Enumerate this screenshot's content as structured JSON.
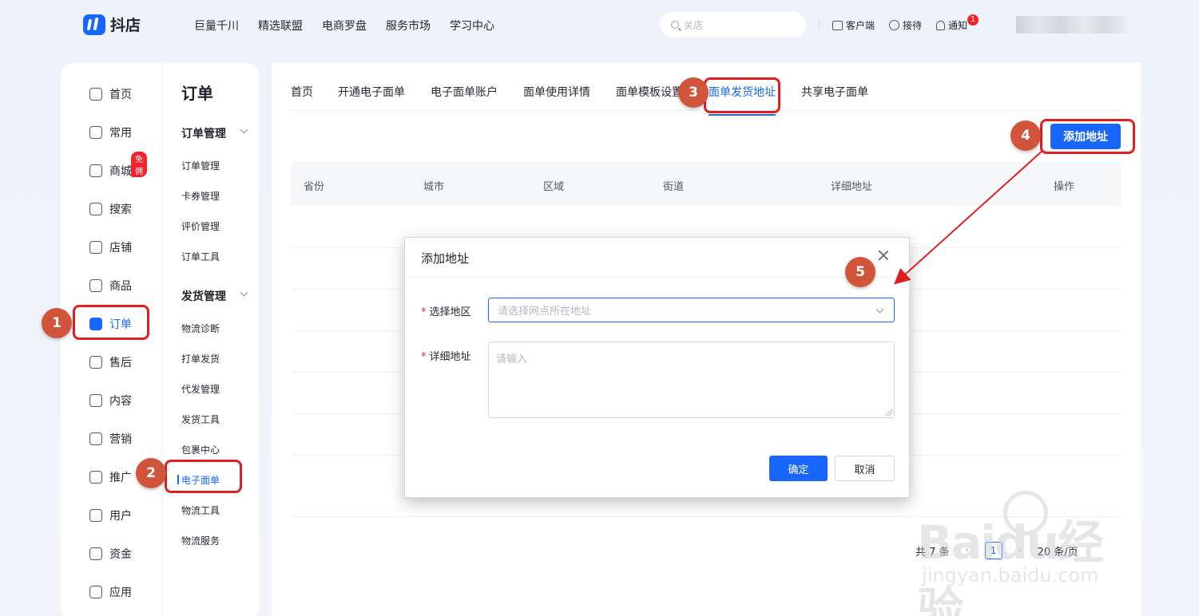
{
  "header": {
    "logo": "抖店",
    "nav": [
      "巨量千川",
      "精选联盟",
      "电商罗盘",
      "服务市场",
      "学习中心"
    ],
    "search_placeholder": "关店",
    "actions": [
      "客户端",
      "接待",
      "通知"
    ],
    "notice_count": "1"
  },
  "sidebar": {
    "items": [
      "首页",
      "常用",
      "商城",
      "搜索",
      "店铺",
      "商品",
      "订单",
      "售后",
      "内容",
      "营销",
      "推广",
      "用户",
      "资金",
      "应用"
    ],
    "mall_badge": "免佣",
    "active_item": "订单"
  },
  "submenu": {
    "title": "订单",
    "group1": "订单管理",
    "group1_items": [
      "订单管理",
      "卡券管理",
      "评价管理",
      "订单工具"
    ],
    "group2": "发货管理",
    "group2_items": [
      "物流诊断",
      "打单发货",
      "代发管理",
      "发货工具",
      "包裹中心",
      "电子面单",
      "物流工具",
      "物流服务"
    ],
    "active_item": "电子面单"
  },
  "main": {
    "tabs": [
      "首页",
      "开通电子面单",
      "电子面单账户",
      "面单使用详情",
      "面单模板设置",
      "面单发货地址",
      "共享电子面单"
    ],
    "active_tab": "面单发货地址",
    "add_button": "添加地址",
    "columns": [
      "省份",
      "城市",
      "区域",
      "街道",
      "详细地址",
      "操作"
    ],
    "pager": {
      "total": "共 7 条",
      "page": "1",
      "page_size": "20 条/页"
    }
  },
  "modal": {
    "title": "添加地址",
    "region_label": "选择地区",
    "region_placeholder": "请选择网点所在地址",
    "address_label": "详细地址",
    "address_placeholder": "请输入",
    "ok": "确定",
    "cancel": "取消"
  },
  "annotations": [
    "1",
    "2",
    "3",
    "4",
    "5"
  ],
  "watermark": {
    "main": "Baidu经验",
    "sub": "jingyan.baidu.com"
  },
  "colors": {
    "accent": "#1966ff",
    "highlight": "#e02020",
    "step_marker": "#d1553a"
  }
}
